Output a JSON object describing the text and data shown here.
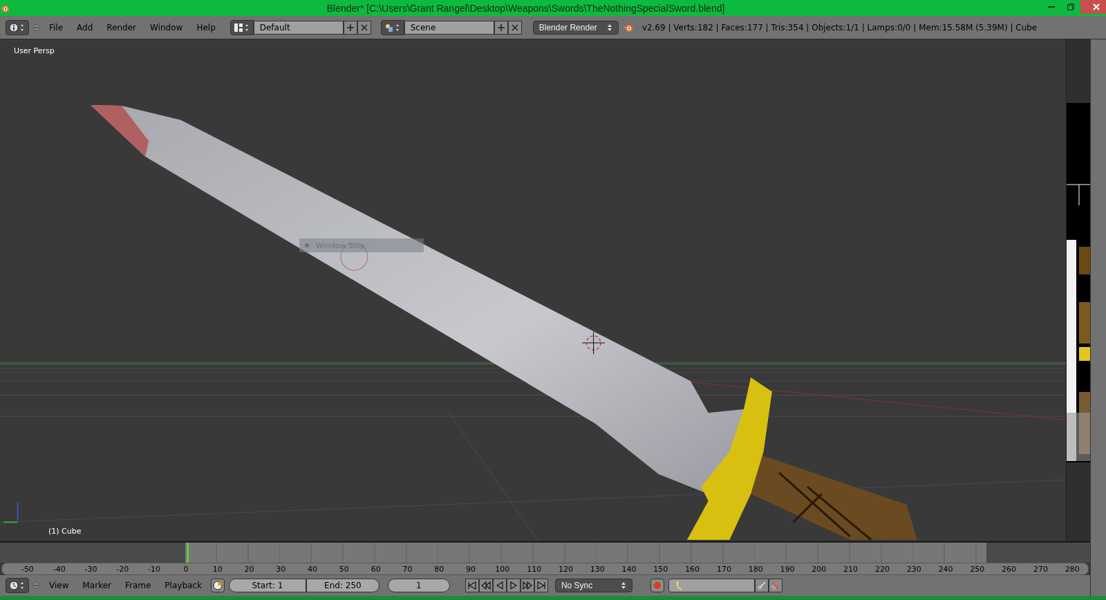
{
  "window": {
    "title": "Blender* [C:\\Users\\Grant Rangel\\Desktop\\Weapons\\Swords\\TheNothingSpecialSword.blend]"
  },
  "header": {
    "menus": [
      "File",
      "Add",
      "Render",
      "Window",
      "Help"
    ],
    "layout": "Default",
    "scene": "Scene",
    "engine": "Blender Render",
    "stats": "v2.69 | Verts:182 | Faces:177 | Tris:354 | Objects:1/1 | Lamps:0/0 | Mem:15.58M (5.39M) | Cube"
  },
  "viewport": {
    "view_label": "User Persp",
    "object_label": "(1) Cube",
    "overlay": "Window Snip"
  },
  "timeline": {
    "playhead": {
      "level": 0.171
    },
    "ticks": [
      "-50",
      "-40",
      "-30",
      "-20",
      "-10",
      "0",
      "10",
      "20",
      "30",
      "40",
      "50",
      "60",
      "70",
      "80",
      "90",
      "100",
      "110",
      "120",
      "130",
      "140",
      "150",
      "160",
      "170",
      "180",
      "190",
      "200",
      "210",
      "220",
      "230",
      "240",
      "250",
      "260",
      "270",
      "280"
    ]
  },
  "footer": {
    "menus": [
      "View",
      "Marker",
      "Frame",
      "Playback"
    ],
    "start": "Start: 1",
    "end": "End: 250",
    "frame": "1",
    "sync": "No Sync"
  }
}
